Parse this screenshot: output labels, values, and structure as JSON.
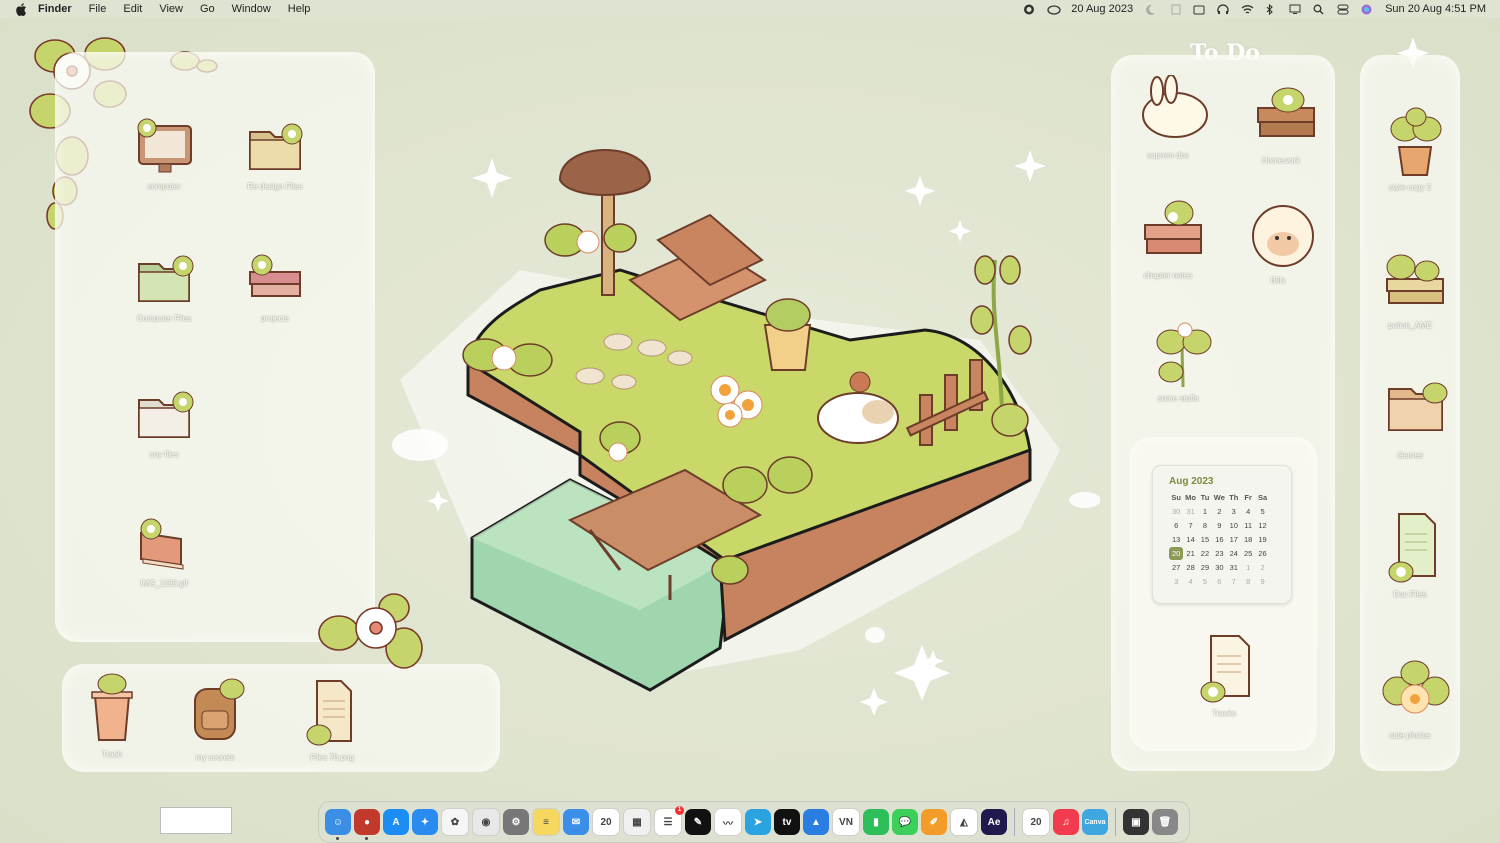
{
  "menubar": {
    "app": "Finder",
    "items": [
      "File",
      "Edit",
      "View",
      "Go",
      "Window",
      "Help"
    ],
    "date_short": "20 Aug 2023",
    "clock": "Sun 20 Aug  4:51 PM"
  },
  "left_panel": {
    "icons": [
      {
        "label": "computer",
        "icon": "computer-icon"
      },
      {
        "label": "Re design Files",
        "icon": "folder-icon"
      },
      {
        "label": "Computer Files",
        "icon": "folder-icon"
      },
      {
        "label": "projects",
        "icon": "books-icon"
      },
      {
        "label": "coy files",
        "icon": "folder-icon"
      },
      {
        "label": "IMG_1183.gif",
        "icon": "book-icon"
      }
    ]
  },
  "bottom_panel": {
    "icons": [
      {
        "label": "Trash",
        "icon": "trash-icon"
      },
      {
        "label": "my secrets",
        "icon": "backpack-icon"
      },
      {
        "label": "Files 76.png",
        "icon": "document-icon"
      }
    ]
  },
  "todo_title": "To Do",
  "todo_panel": {
    "icons": [
      {
        "label": "suprem doc",
        "icon": "bunny-icon"
      },
      {
        "label": "Homework",
        "icon": "books-icon"
      },
      {
        "label": "chapter notes",
        "icon": "books-icon"
      },
      {
        "label": "Bills",
        "icon": "sheep-icon"
      },
      {
        "label": "some stuffs",
        "icon": "plant-icon"
      }
    ]
  },
  "widget_panel": {
    "calendar": {
      "month": "Aug 2023",
      "weekdays": [
        "Su",
        "Mo",
        "Tu",
        "We",
        "Th",
        "Fr",
        "Sa"
      ],
      "weeks": [
        [
          "30",
          "31",
          "1",
          "2",
          "3",
          "4",
          "5"
        ],
        [
          "6",
          "7",
          "8",
          "9",
          "10",
          "11",
          "12"
        ],
        [
          "13",
          "14",
          "15",
          "16",
          "17",
          "18",
          "19"
        ],
        [
          "20",
          "21",
          "22",
          "23",
          "24",
          "25",
          "26"
        ],
        [
          "27",
          "28",
          "29",
          "30",
          "31",
          "1",
          "2"
        ],
        [
          "3",
          "4",
          "5",
          "6",
          "7",
          "8",
          "9"
        ]
      ],
      "today": "20"
    },
    "icon": {
      "label": "Tracks",
      "icon": "document-icon"
    }
  },
  "right_panel": {
    "icons": [
      {
        "label": "style copy 2",
        "icon": "plant-pot-icon"
      },
      {
        "label": "potion_AME",
        "icon": "books-icon"
      },
      {
        "label": "Games",
        "icon": "folder-icon"
      },
      {
        "label": "Doc Files",
        "icon": "document-icon"
      },
      {
        "label": "cute photos",
        "icon": "flower-icon"
      }
    ]
  },
  "dock": {
    "apps": [
      {
        "name": "finder",
        "color": "#3a8ee6",
        "glyph": "☺",
        "running": true
      },
      {
        "name": "app-red-face",
        "color": "#c0392b",
        "glyph": "●",
        "running": true
      },
      {
        "name": "app-store",
        "color": "#1c8ef3",
        "glyph": "A"
      },
      {
        "name": "safari",
        "color": "#2a8cf0",
        "glyph": "✦"
      },
      {
        "name": "photos",
        "color": "#f5f5f5",
        "glyph": "✿"
      },
      {
        "name": "chrome",
        "color": "#e8e8e8",
        "glyph": "◉"
      },
      {
        "name": "system-settings",
        "color": "#777777",
        "glyph": "⚙"
      },
      {
        "name": "notes",
        "color": "#f6d860",
        "glyph": "≡"
      },
      {
        "name": "mail",
        "color": "#3b8fe8",
        "glyph": "✉"
      },
      {
        "name": "calendar",
        "color": "#ffffff",
        "glyph": "20"
      },
      {
        "name": "launchpad",
        "color": "#f0f0f0",
        "glyph": "▦"
      },
      {
        "name": "reminders",
        "color": "#ffffff",
        "glyph": "☰",
        "badge": "1"
      },
      {
        "name": "app-black",
        "color": "#111111",
        "glyph": "✎"
      },
      {
        "name": "freeform",
        "color": "#ffffff",
        "glyph": "〰"
      },
      {
        "name": "telegram",
        "color": "#2aa3e0",
        "glyph": "➤"
      },
      {
        "name": "apple-tv",
        "color": "#111111",
        "glyph": "tv"
      },
      {
        "name": "keynote",
        "color": "#2a7de1",
        "glyph": "▲"
      },
      {
        "name": "vn-editor",
        "color": "#ffffff",
        "glyph": "VN"
      },
      {
        "name": "numbers",
        "color": "#2fbf5a",
        "glyph": "▮"
      },
      {
        "name": "messages",
        "color": "#3ccf5a",
        "glyph": "💬"
      },
      {
        "name": "pages",
        "color": "#f39c2a",
        "glyph": "✐"
      },
      {
        "name": "affinity",
        "color": "#ffffff",
        "glyph": "◭"
      },
      {
        "name": "after-effects",
        "color": "#1f1a4d",
        "glyph": "Ae"
      },
      {
        "name": "calendar-2",
        "color": "#ffffff",
        "glyph": "20"
      },
      {
        "name": "music",
        "color": "#f23b4f",
        "glyph": "♫"
      },
      {
        "name": "canva",
        "color": "#3fa6e0",
        "glyph": "Canva"
      },
      {
        "name": "screen-recorder",
        "color": "#333333",
        "glyph": "▣"
      },
      {
        "name": "trash",
        "color": "#888888",
        "glyph": "🗑"
      }
    ]
  },
  "colors": {
    "leaf": "#c6d56b",
    "leaf_dark": "#8da646",
    "outline": "#7a3a2a",
    "petal": "#ffffff",
    "wood": "#b97a57",
    "grass": "#c9d869",
    "water": "#8fd1a3",
    "cal_accent": "#8b9a55"
  }
}
